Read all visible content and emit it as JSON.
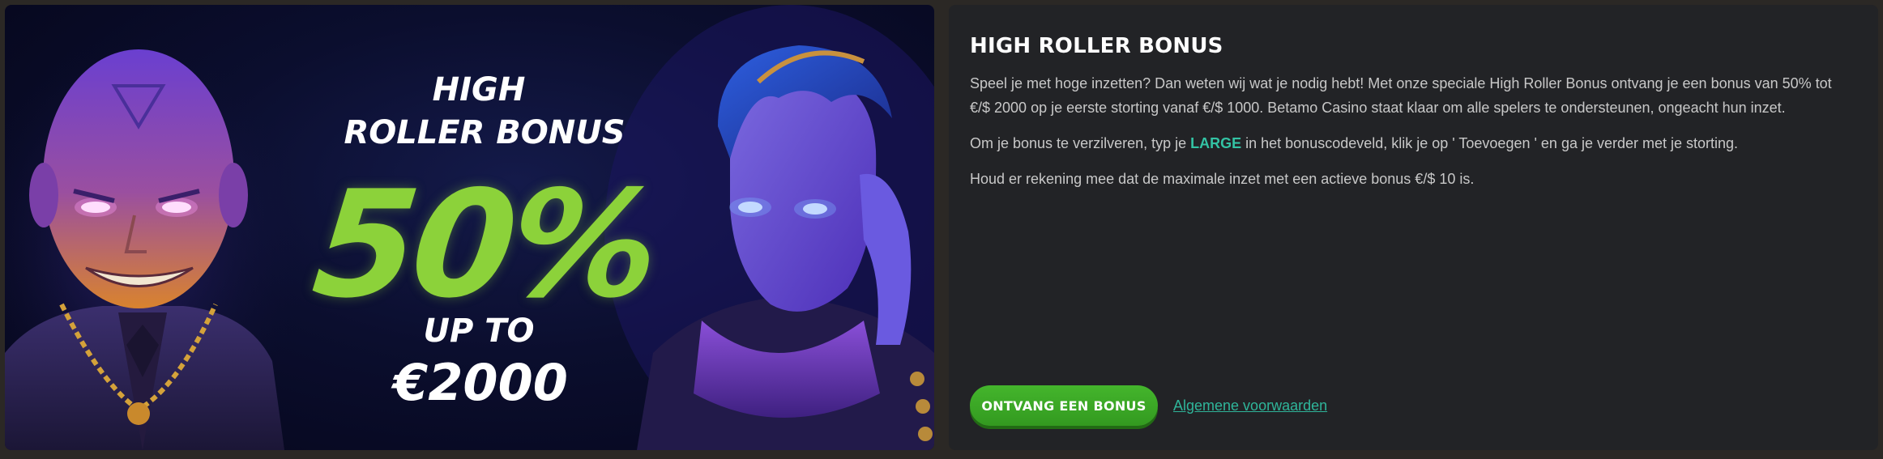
{
  "banner": {
    "line_high": "HIGH",
    "line_roller": "ROLLER BONUS",
    "percent": "50%",
    "line_upto": "UP TO",
    "amount": "€2000",
    "accent_color": "#8cd23a"
  },
  "panel": {
    "title": "HIGH ROLLER BONUS",
    "paragraph_1": "Speel je met hoge inzetten? Dan weten wij wat je nodig hebt! Met onze speciale High Roller Bonus ontvang je een bonus van 50% tot €/$ 2000 op je eerste storting vanaf €/$ 1000. Betamo Casino staat klaar om alle spelers te ondersteunen, ongeacht hun inzet.",
    "paragraph_2_before": "Om je bonus te verzilveren, typ je ",
    "bonus_code": "LARGE",
    "paragraph_2_after": " in het bonuscodeveld, klik je op ' Toevoegen ' en ga je verder met je storting.",
    "paragraph_3": "Houd er rekening mee dat de maximale inzet met een actieve bonus €/$ 10 is.",
    "cta_label": "ONTVANG EEN BONUS",
    "terms_label": "Algemene voorwaarden",
    "cta_color": "#3ea827",
    "link_color": "#2fb59a"
  }
}
